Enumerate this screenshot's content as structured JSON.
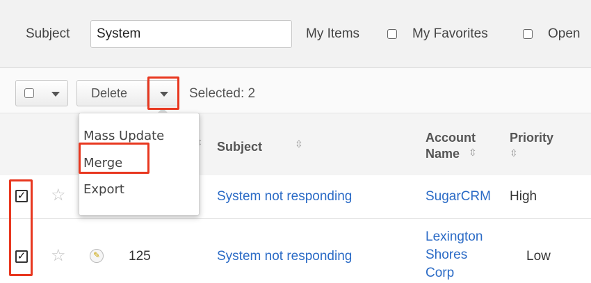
{
  "filter": {
    "subject_label": "Subject",
    "subject_value": "System",
    "my_items_label": "My Items",
    "my_favorites_label": "My Favorites",
    "open_label": "Open"
  },
  "toolbar": {
    "delete_label": "Delete",
    "selected_text": "Selected: 2"
  },
  "actions_menu": {
    "items": [
      "Mass Update",
      "Merge",
      "Export"
    ]
  },
  "table": {
    "headers": {
      "subject": "Subject",
      "account_line1": "Account",
      "account_line2": "Name",
      "priority": "Priority"
    },
    "rows": [
      {
        "checked": true,
        "number": "",
        "subject": "System not responding",
        "account": "SugarCRM",
        "priority": "High"
      },
      {
        "checked": true,
        "number": "125",
        "subject": "System not responding",
        "account_lines": [
          "Lexington",
          "Shores",
          "Corp"
        ],
        "priority": "Low"
      }
    ]
  },
  "colors": {
    "link": "#2b6bc6",
    "highlight": "#e8371f"
  }
}
